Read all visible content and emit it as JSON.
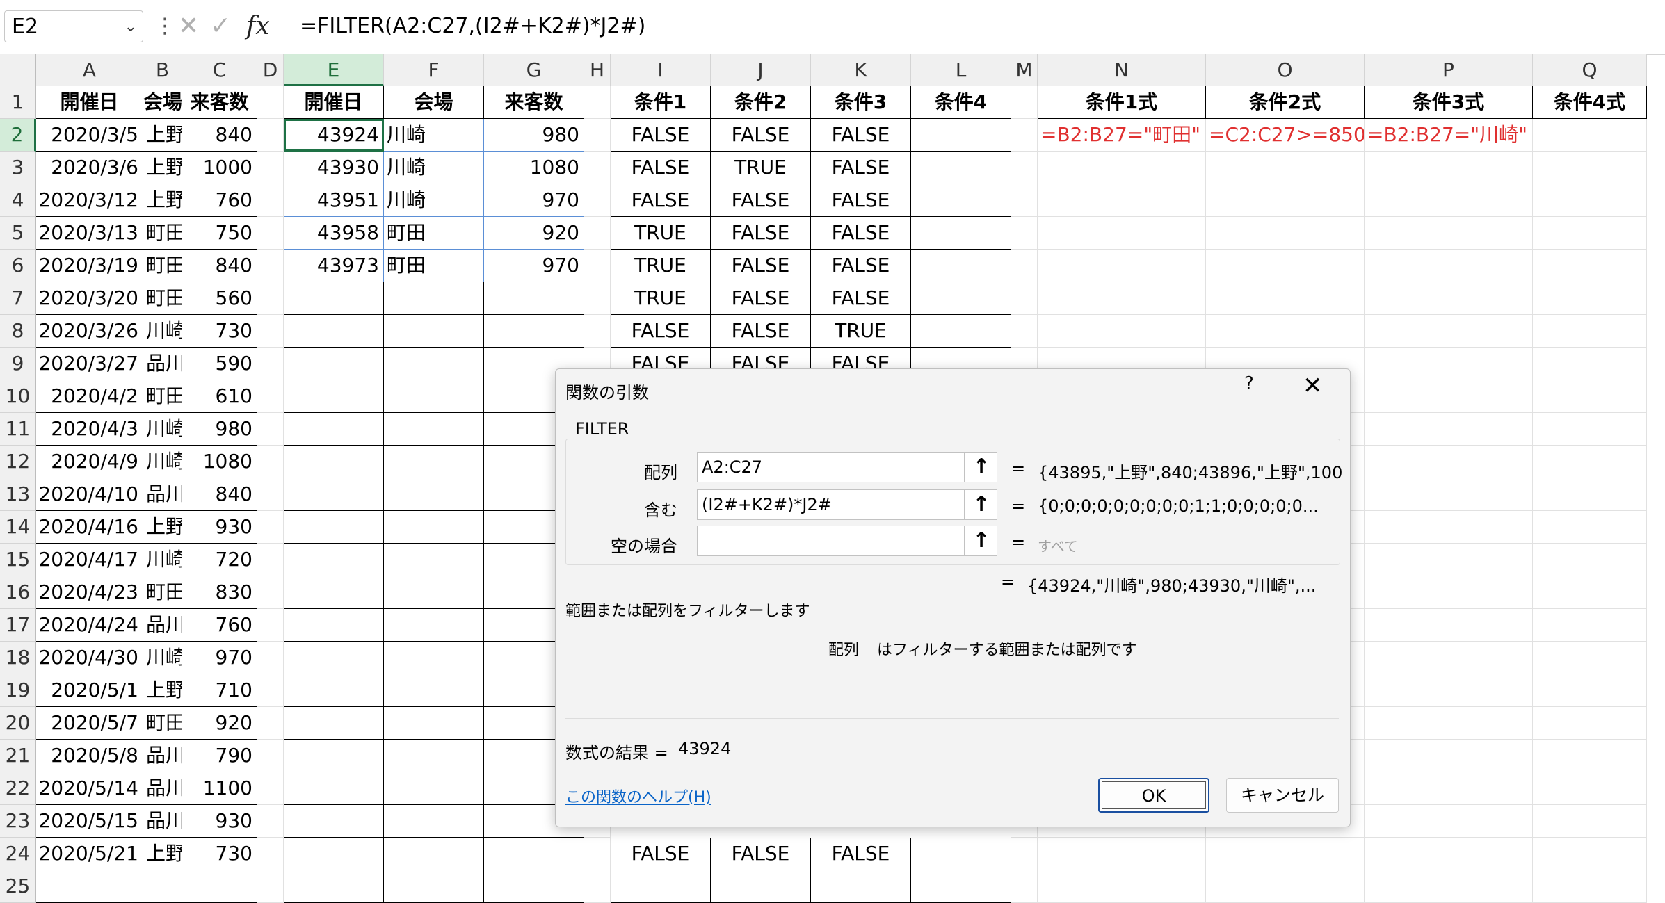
{
  "formula_bar": {
    "name_box": "E2",
    "formula": "=FILTER(A2:C27,(I2#+K2#)*J2#)"
  },
  "columns": [
    "A",
    "B",
    "C",
    "D",
    "E",
    "F",
    "G",
    "H",
    "I",
    "J",
    "K",
    "L",
    "M",
    "N",
    "O",
    "P",
    "Q"
  ],
  "rows": [
    "1",
    "2",
    "3",
    "4",
    "5",
    "6",
    "7",
    "8",
    "9",
    "10",
    "11",
    "12",
    "13",
    "14",
    "15",
    "16",
    "17",
    "18",
    "19",
    "20",
    "21",
    "22",
    "23",
    "24",
    "25"
  ],
  "source_table": {
    "headers": [
      "開催日",
      "会場",
      "来客数"
    ],
    "rows": [
      [
        "2020/3/5",
        "上野",
        "840"
      ],
      [
        "2020/3/6",
        "上野",
        "1000"
      ],
      [
        "2020/3/12",
        "上野",
        "760"
      ],
      [
        "2020/3/13",
        "町田",
        "750"
      ],
      [
        "2020/3/19",
        "町田",
        "840"
      ],
      [
        "2020/3/20",
        "町田",
        "560"
      ],
      [
        "2020/3/26",
        "川崎",
        "730"
      ],
      [
        "2020/3/27",
        "品川",
        "590"
      ],
      [
        "2020/4/2",
        "町田",
        "610"
      ],
      [
        "2020/4/3",
        "川崎",
        "980"
      ],
      [
        "2020/4/9",
        "川崎",
        "1080"
      ],
      [
        "2020/4/10",
        "品川",
        "840"
      ],
      [
        "2020/4/16",
        "上野",
        "930"
      ],
      [
        "2020/4/17",
        "川崎",
        "720"
      ],
      [
        "2020/4/23",
        "町田",
        "830"
      ],
      [
        "2020/4/24",
        "品川",
        "760"
      ],
      [
        "2020/4/30",
        "川崎",
        "970"
      ],
      [
        "2020/5/1",
        "上野",
        "710"
      ],
      [
        "2020/5/7",
        "町田",
        "920"
      ],
      [
        "2020/5/8",
        "品川",
        "790"
      ],
      [
        "2020/5/14",
        "品川",
        "1100"
      ],
      [
        "2020/5/15",
        "品川",
        "930"
      ],
      [
        "2020/5/21",
        "上野",
        "730"
      ]
    ]
  },
  "result_table": {
    "headers": [
      "開催日",
      "会場",
      "来客数"
    ],
    "rows": [
      [
        "43924",
        "川崎",
        "980"
      ],
      [
        "43930",
        "川崎",
        "1080"
      ],
      [
        "43951",
        "川崎",
        "970"
      ],
      [
        "43958",
        "町田",
        "920"
      ],
      [
        "43973",
        "町田",
        "970"
      ]
    ]
  },
  "cond_table": {
    "headers": [
      "条件1",
      "条件2",
      "条件3",
      "条件4"
    ],
    "rows": [
      [
        "FALSE",
        "FALSE",
        "FALSE"
      ],
      [
        "FALSE",
        "TRUE",
        "FALSE"
      ],
      [
        "FALSE",
        "FALSE",
        "FALSE"
      ],
      [
        "TRUE",
        "FALSE",
        "FALSE"
      ],
      [
        "TRUE",
        "FALSE",
        "FALSE"
      ],
      [
        "TRUE",
        "FALSE",
        "FALSE"
      ],
      [
        "FALSE",
        "FALSE",
        "TRUE"
      ],
      [
        "FALSE",
        "FALSE",
        "FALSE"
      ]
    ],
    "row24": [
      "FALSE",
      "FALSE",
      "FALSE"
    ]
  },
  "formula_table": {
    "headers": [
      "条件1式",
      "条件2式",
      "条件3式",
      "条件4式"
    ],
    "values": [
      "=B2:B27=\"町田\"",
      "=C2:C27>=850",
      "=B2:B27=\"川崎\""
    ]
  },
  "dialog": {
    "title": "関数の引数",
    "help_glyph": "?",
    "close_glyph": "✕",
    "function_name": "FILTER",
    "args": [
      {
        "label": "配列",
        "value": "A2:C27",
        "result": "{43895,\"上野\",840;43896,\"上野\",100"
      },
      {
        "label": "含む",
        "value": "(I2#+K2#)*J2#",
        "result": "{0;0;0;0;0;0;0;0;0;1;1;0;0;0;0;0..."
      },
      {
        "label": "空の場合",
        "value": "",
        "result": "すべて"
      }
    ],
    "equals": "=",
    "overall_result": "{43924,\"川崎\",980;43930,\"川崎\",...",
    "description": "範囲または配列をフィルターします",
    "arg_help_name": "配列",
    "arg_help_text": "はフィルターする範囲または配列です",
    "formula_result_label": "数式の結果 =",
    "formula_result_value": "43924",
    "help_link": "この関数のヘルプ(H)",
    "ok_label": "OK",
    "cancel_label": "キャンセル"
  }
}
